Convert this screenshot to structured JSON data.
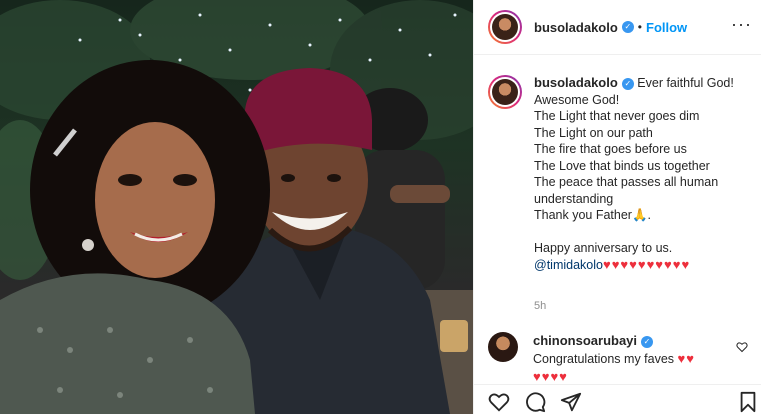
{
  "header": {
    "username": "busoladakolo",
    "separator": "•",
    "follow_label": "Follow",
    "more_label": "···"
  },
  "caption": {
    "username": "busoladakolo",
    "text": "Ever faithful God!\nAwesome God!\nThe Light that never goes dim\nThe Light on our path\nThe fire that goes before us\nThe Love that binds us together\nThe peace that passes all human understanding\nThank you Father🙏.",
    "anniversary": "Happy anniversary to us.",
    "mention": "@timidakolo",
    "hearts": "♥♥♥♥♥♥♥♥♥♥",
    "time": "5h"
  },
  "comment": {
    "username": "chinonsoarubayi",
    "text": "Congratulations my faves",
    "hearts_inline": "♥♥",
    "hearts_next": "♥♥♥♥"
  },
  "colors": {
    "link": "#0095f6",
    "mention": "#00376b",
    "heart": "#ed2f3c",
    "muted": "#8e8e8e",
    "verified": "#3897f0"
  },
  "icons": {
    "verified": "verified-badge-icon",
    "more": "more-options-icon",
    "like": "heart-icon",
    "comment": "comment-icon",
    "share": "share-icon",
    "save": "bookmark-icon"
  }
}
